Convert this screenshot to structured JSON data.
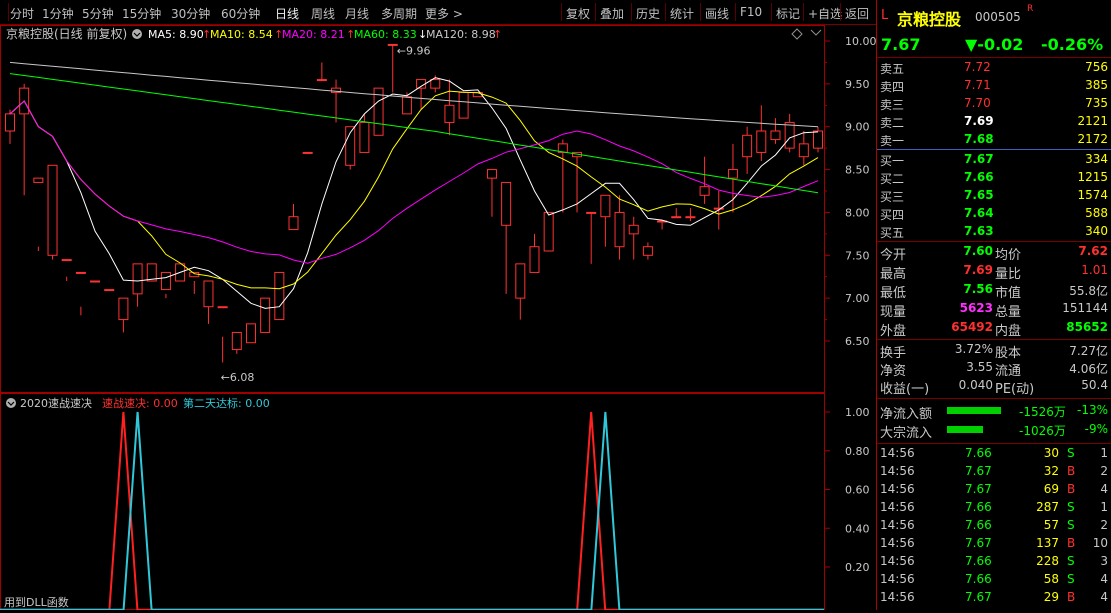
{
  "toolbar": {
    "periods": [
      "分时",
      "1分钟",
      "5分钟",
      "15分钟",
      "30分钟",
      "60分钟",
      "日线",
      "周线",
      "月线",
      "多周期",
      "更多 >"
    ],
    "active": "日线",
    "actions": [
      "复权",
      "叠加",
      "历史",
      "统计",
      "画线",
      "F10",
      "标记",
      "+自选",
      "返回"
    ]
  },
  "main_chart": {
    "stock_name": "京粮控股(日线 前复权)",
    "ma_labels": [
      {
        "text": "MA5: 8.90",
        "arrow": "↑",
        "color": "#ffffff"
      },
      {
        "text": "MA10: 8.54",
        "arrow": "↑",
        "color": "#ffff00"
      },
      {
        "text": "MA20: 8.21",
        "arrow": "↑",
        "color": "#ff00ff"
      },
      {
        "text": "MA60: 8.33",
        "arrow": "↓",
        "color": "#00ff00"
      },
      {
        "text": "MA120: 8.98",
        "arrow": "↑",
        "color": "#c8c8c8"
      }
    ],
    "high_label": "9.96",
    "low_label": "6.08",
    "y_ticks": [
      "10.00",
      "9.50",
      "9.00",
      "8.50",
      "8.00",
      "7.50",
      "7.00",
      "6.50"
    ]
  },
  "chart_data": [
    {
      "type": "candlestick",
      "title": "京粮控股(日线 前复权)",
      "ylim": [
        6.0,
        10.1
      ],
      "ohlc": [
        [
          8.95,
          9.15,
          8.8,
          9.2
        ],
        [
          9.15,
          9.45,
          8.2,
          9.5
        ],
        [
          8.35,
          8.4,
          7.55,
          7.6
        ],
        [
          7.5,
          8.55,
          7.55,
          7.45
        ],
        [
          7.45,
          7.45,
          7.2,
          7.25
        ],
        [
          7.3,
          7.3,
          6.8,
          6.9
        ],
        [
          7.2,
          7.2,
          6.6,
          6.6
        ],
        [
          7.1,
          7.1,
          6.8,
          6.8
        ],
        [
          6.75,
          7.0,
          6.6,
          7.0
        ],
        [
          7.05,
          7.4,
          6.9,
          7.3
        ],
        [
          7.2,
          7.4,
          7.3,
          7.35
        ],
        [
          7.1,
          7.3,
          7.0,
          7.05
        ],
        [
          7.2,
          7.4,
          7.2,
          7.35
        ],
        [
          7.25,
          7.3,
          7.05,
          7.2
        ],
        [
          6.9,
          7.2,
          6.7,
          7.15
        ],
        [
          6.9,
          6.9,
          6.25,
          6.55
        ],
        [
          6.4,
          6.6,
          6.35,
          6.5
        ],
        [
          6.48,
          6.7,
          6.55,
          6.6
        ],
        [
          6.6,
          7.0,
          6.7,
          7.0
        ],
        [
          6.75,
          7.3,
          7.05,
          7.25
        ],
        [
          7.8,
          7.95,
          7.8,
          8.1
        ],
        [
          8.7,
          8.7,
          8.7,
          8.7
        ],
        [
          9.55,
          9.55,
          9.55,
          9.75
        ],
        [
          9.4,
          9.45,
          9.05,
          9.55
        ],
        [
          8.55,
          9.0,
          8.5,
          8.95
        ],
        [
          8.7,
          9.05,
          8.7,
          9.15
        ],
        [
          8.9,
          9.45,
          8.9,
          9.45
        ],
        [
          9.96,
          9.96,
          9.4,
          9.96
        ],
        [
          9.15,
          9.35,
          9.25,
          9.4
        ],
        [
          9.45,
          9.55,
          9.2,
          9.55
        ],
        [
          9.45,
          9.55,
          9.4,
          9.6
        ],
        [
          9.05,
          9.25,
          8.9,
          9.55
        ],
        [
          9.1,
          9.4,
          9.1,
          9.3
        ],
        [
          9.35,
          9.4,
          8.5,
          8.5
        ],
        [
          8.4,
          8.5,
          7.95,
          8.5
        ],
        [
          7.85,
          8.35,
          7.05,
          8.35
        ],
        [
          7.0,
          7.4,
          6.75,
          7.4
        ],
        [
          7.3,
          7.6,
          7.5,
          7.75
        ],
        [
          7.55,
          8.0,
          7.75,
          8.0
        ],
        [
          8.7,
          8.8,
          8.0,
          8.85
        ],
        [
          8.65,
          8.7,
          8.0,
          8.7
        ],
        [
          8.0,
          8.0,
          7.4,
          8.0
        ],
        [
          7.95,
          8.2,
          7.6,
          8.2
        ],
        [
          7.6,
          8.0,
          7.45,
          8.2
        ],
        [
          7.75,
          7.85,
          7.45,
          7.95
        ],
        [
          7.5,
          7.6,
          7.45,
          7.65
        ],
        [
          7.9,
          7.9,
          7.8,
          7.9
        ],
        [
          7.95,
          7.95,
          7.95,
          8.05
        ],
        [
          7.95,
          7.95,
          7.9,
          8.05
        ],
        [
          8.2,
          8.3,
          8.1,
          8.65
        ],
        [
          8.05,
          8.05,
          7.8,
          8.25
        ],
        [
          8.4,
          8.5,
          8.0,
          8.8
        ],
        [
          8.65,
          8.9,
          8.45,
          9.0
        ],
        [
          8.7,
          8.95,
          8.6,
          9.25
        ],
        [
          8.85,
          8.95,
          8.8,
          9.1
        ],
        [
          8.75,
          9.05,
          8.7,
          9.15
        ],
        [
          8.65,
          8.8,
          8.55,
          8.95
        ],
        [
          8.75,
          8.95,
          8.7,
          9.0
        ]
      ],
      "ohlc_order": "open, close, low, high",
      "series": [
        {
          "name": "MA5",
          "color": "#ffffff",
          "last": 8.9
        },
        {
          "name": "MA10",
          "color": "#ffff00",
          "last": 8.54
        },
        {
          "name": "MA20",
          "color": "#ff00ff",
          "last": 8.21
        },
        {
          "name": "MA60",
          "color": "#00ff00",
          "last": 8.33
        },
        {
          "name": "MA120",
          "color": "#c8c8c8",
          "last": 8.98
        }
      ]
    },
    {
      "type": "line",
      "title": "2020速战速决",
      "ylim": [
        0,
        1.0
      ],
      "y_ticks": [
        "1.00",
        "0.80",
        "0.60",
        "0.40",
        "0.20"
      ],
      "series": [
        {
          "name": "速战速决",
          "color": "#ff2020",
          "value": 0.0,
          "spikes_at": [
            8,
            41
          ]
        },
        {
          "name": "第二天达标",
          "color": "#30c8d8",
          "value": 0.0,
          "spikes_at": [
            9,
            42
          ]
        }
      ]
    }
  ],
  "indicator": {
    "title": "2020速战速决",
    "s1": "速战速决: 0.00",
    "s2": "第二天达标: 0.00",
    "footer": "用到DLL函数"
  },
  "panel": {
    "prefix": "L",
    "name": "京粮控股",
    "code": "000505",
    "badge": "R",
    "price": "7.67",
    "change": "▼-0.02",
    "pct": "-0.26%",
    "asks": [
      {
        "label": "卖五",
        "price": "7.72",
        "vol": "756"
      },
      {
        "label": "卖四",
        "price": "7.71",
        "vol": "385"
      },
      {
        "label": "卖三",
        "price": "7.70",
        "vol": "735"
      },
      {
        "label": "卖二",
        "price": "7.69",
        "vol": "2121"
      },
      {
        "label": "卖一",
        "price": "7.68",
        "vol": "2172"
      }
    ],
    "bids": [
      {
        "label": "买一",
        "price": "7.67",
        "vol": "334"
      },
      {
        "label": "买二",
        "price": "7.66",
        "vol": "1215"
      },
      {
        "label": "买三",
        "price": "7.65",
        "vol": "1574"
      },
      {
        "label": "买四",
        "price": "7.64",
        "vol": "588"
      },
      {
        "label": "买五",
        "price": "7.63",
        "vol": "340"
      }
    ],
    "stats": [
      {
        "l1": "今开",
        "v1": "7.60",
        "l2": "均价",
        "v2": "7.62"
      },
      {
        "l1": "最高",
        "v1": "7.69",
        "l2": "量比",
        "v2": "1.01"
      },
      {
        "l1": "最低",
        "v1": "7.56",
        "l2": "市值",
        "v2": "55.8亿"
      },
      {
        "l1": "现量",
        "v1": "5623",
        "l2": "总量",
        "v2": "151144"
      },
      {
        "l1": "外盘",
        "v1": "65492",
        "l2": "内盘",
        "v2": "85652"
      }
    ],
    "fin": [
      {
        "l1": "换手",
        "v1": "3.72%",
        "l2": "股本",
        "v2": "7.27亿"
      },
      {
        "l1": "净资",
        "v1": "3.55",
        "l2": "流通",
        "v2": "4.06亿"
      },
      {
        "l1": "收益(一)",
        "v1": "0.040",
        "l2": "PE(动)",
        "v2": "50.4"
      }
    ],
    "flows": [
      {
        "label": "净流入额",
        "value": "-1526万",
        "pct": "-13%"
      },
      {
        "label": "大宗流入",
        "value": "-1026万",
        "pct": "-9%"
      }
    ],
    "trades": [
      {
        "t": "14:56",
        "p": "7.66",
        "v": "30",
        "s": "S",
        "n": "1"
      },
      {
        "t": "14:56",
        "p": "7.67",
        "v": "32",
        "s": "B",
        "n": "2"
      },
      {
        "t": "14:56",
        "p": "7.67",
        "v": "69",
        "s": "B",
        "n": "4"
      },
      {
        "t": "14:56",
        "p": "7.66",
        "v": "287",
        "s": "S",
        "n": "1"
      },
      {
        "t": "14:56",
        "p": "7.66",
        "v": "57",
        "s": "S",
        "n": "2"
      },
      {
        "t": "14:56",
        "p": "7.67",
        "v": "137",
        "s": "B",
        "n": "10"
      },
      {
        "t": "14:56",
        "p": "7.66",
        "v": "228",
        "s": "S",
        "n": "3"
      },
      {
        "t": "14:56",
        "p": "7.66",
        "v": "58",
        "s": "S",
        "n": "4"
      },
      {
        "t": "14:56",
        "p": "7.67",
        "v": "29",
        "s": "B",
        "n": "4"
      }
    ]
  }
}
